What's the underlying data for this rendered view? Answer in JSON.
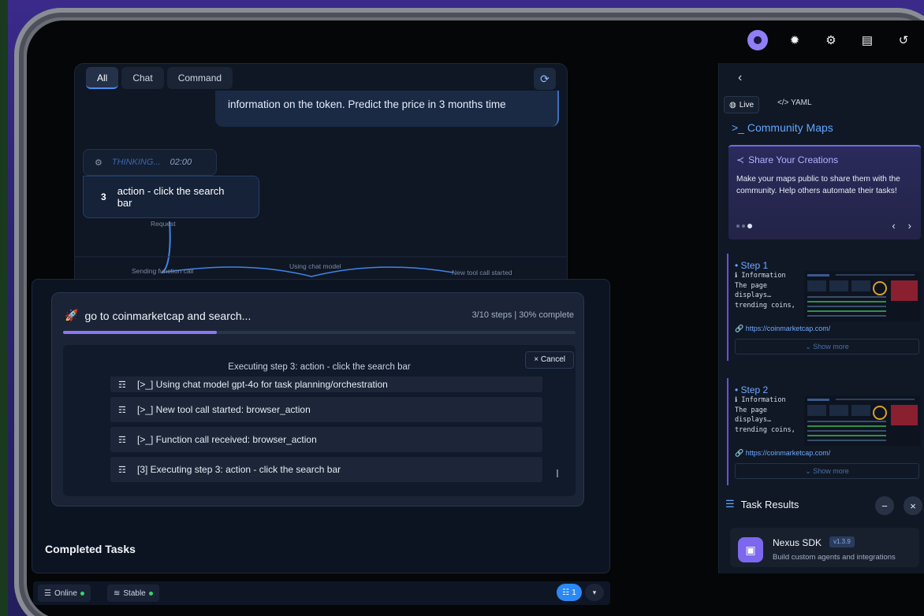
{
  "toolbar": {
    "icons": [
      "user-avatar",
      "gear-icon",
      "settings-icon",
      "document-icon",
      "history-icon"
    ]
  },
  "chat": {
    "tabs": [
      {
        "label": "All",
        "active": true
      },
      {
        "label": "Chat",
        "active": false
      },
      {
        "label": "Command",
        "active": false
      }
    ],
    "user_message_line2": "information on the token. Predict the price in 3 months time",
    "thinking_label": "THINKING...",
    "thinking_time": "02:00",
    "action_step_number": "3",
    "action_text": "action - click the search bar",
    "graph_labels": {
      "request": "Request",
      "sending_function_call": "Sending function call",
      "using_chat_model": "Using chat model",
      "new_tool_call": "New tool call started"
    }
  },
  "task": {
    "title": "go to coinmarketcap and search...",
    "status": "3/10 steps | 30% complete",
    "progress": 0.3,
    "executing_title": "Executing step 3: action - click the search bar",
    "cancel_label": "× Cancel",
    "logs": [
      "[>_] Using chat model gpt-4o for task planning/orchestration",
      "[>_] New tool call started: browser_action",
      "[>_] Function call received: browser_action",
      "[3] Executing step 3: action - click the search bar"
    ],
    "completed_tasks_label": "Completed Tasks"
  },
  "bottom_bar": {
    "online_label": "Online",
    "stable_label": "Stable",
    "count": "1"
  },
  "right_panel": {
    "live_label": "Live",
    "yaml_label": "YAML",
    "community_maps_title": ">_ Community Maps",
    "share_title": "Share Your Creations",
    "share_desc": "Make your maps public to share them with the community. Help others automate their tasks!",
    "steps": [
      {
        "title": "• Step 1",
        "info": "ℹ Information\nThe page\ndisplays…\ntrending coins,",
        "link": "https://coinmarketcap.com/",
        "show_more": "Show more"
      },
      {
        "title": "• Step 2",
        "info": "ℹ Information\nThe page\ndisplays…\ntrending coins,",
        "link": "https://coinmarketcap.com/",
        "show_more": "Show more"
      }
    ],
    "task_results_title": "Task Results",
    "sdk": {
      "name": "Nexus SDK",
      "version": "v1.3.9",
      "description": "Build custom agents and integrations"
    }
  },
  "colors": {
    "accent": "#5fa6ff",
    "progress": "#8b78f0",
    "online": "#37d467"
  }
}
